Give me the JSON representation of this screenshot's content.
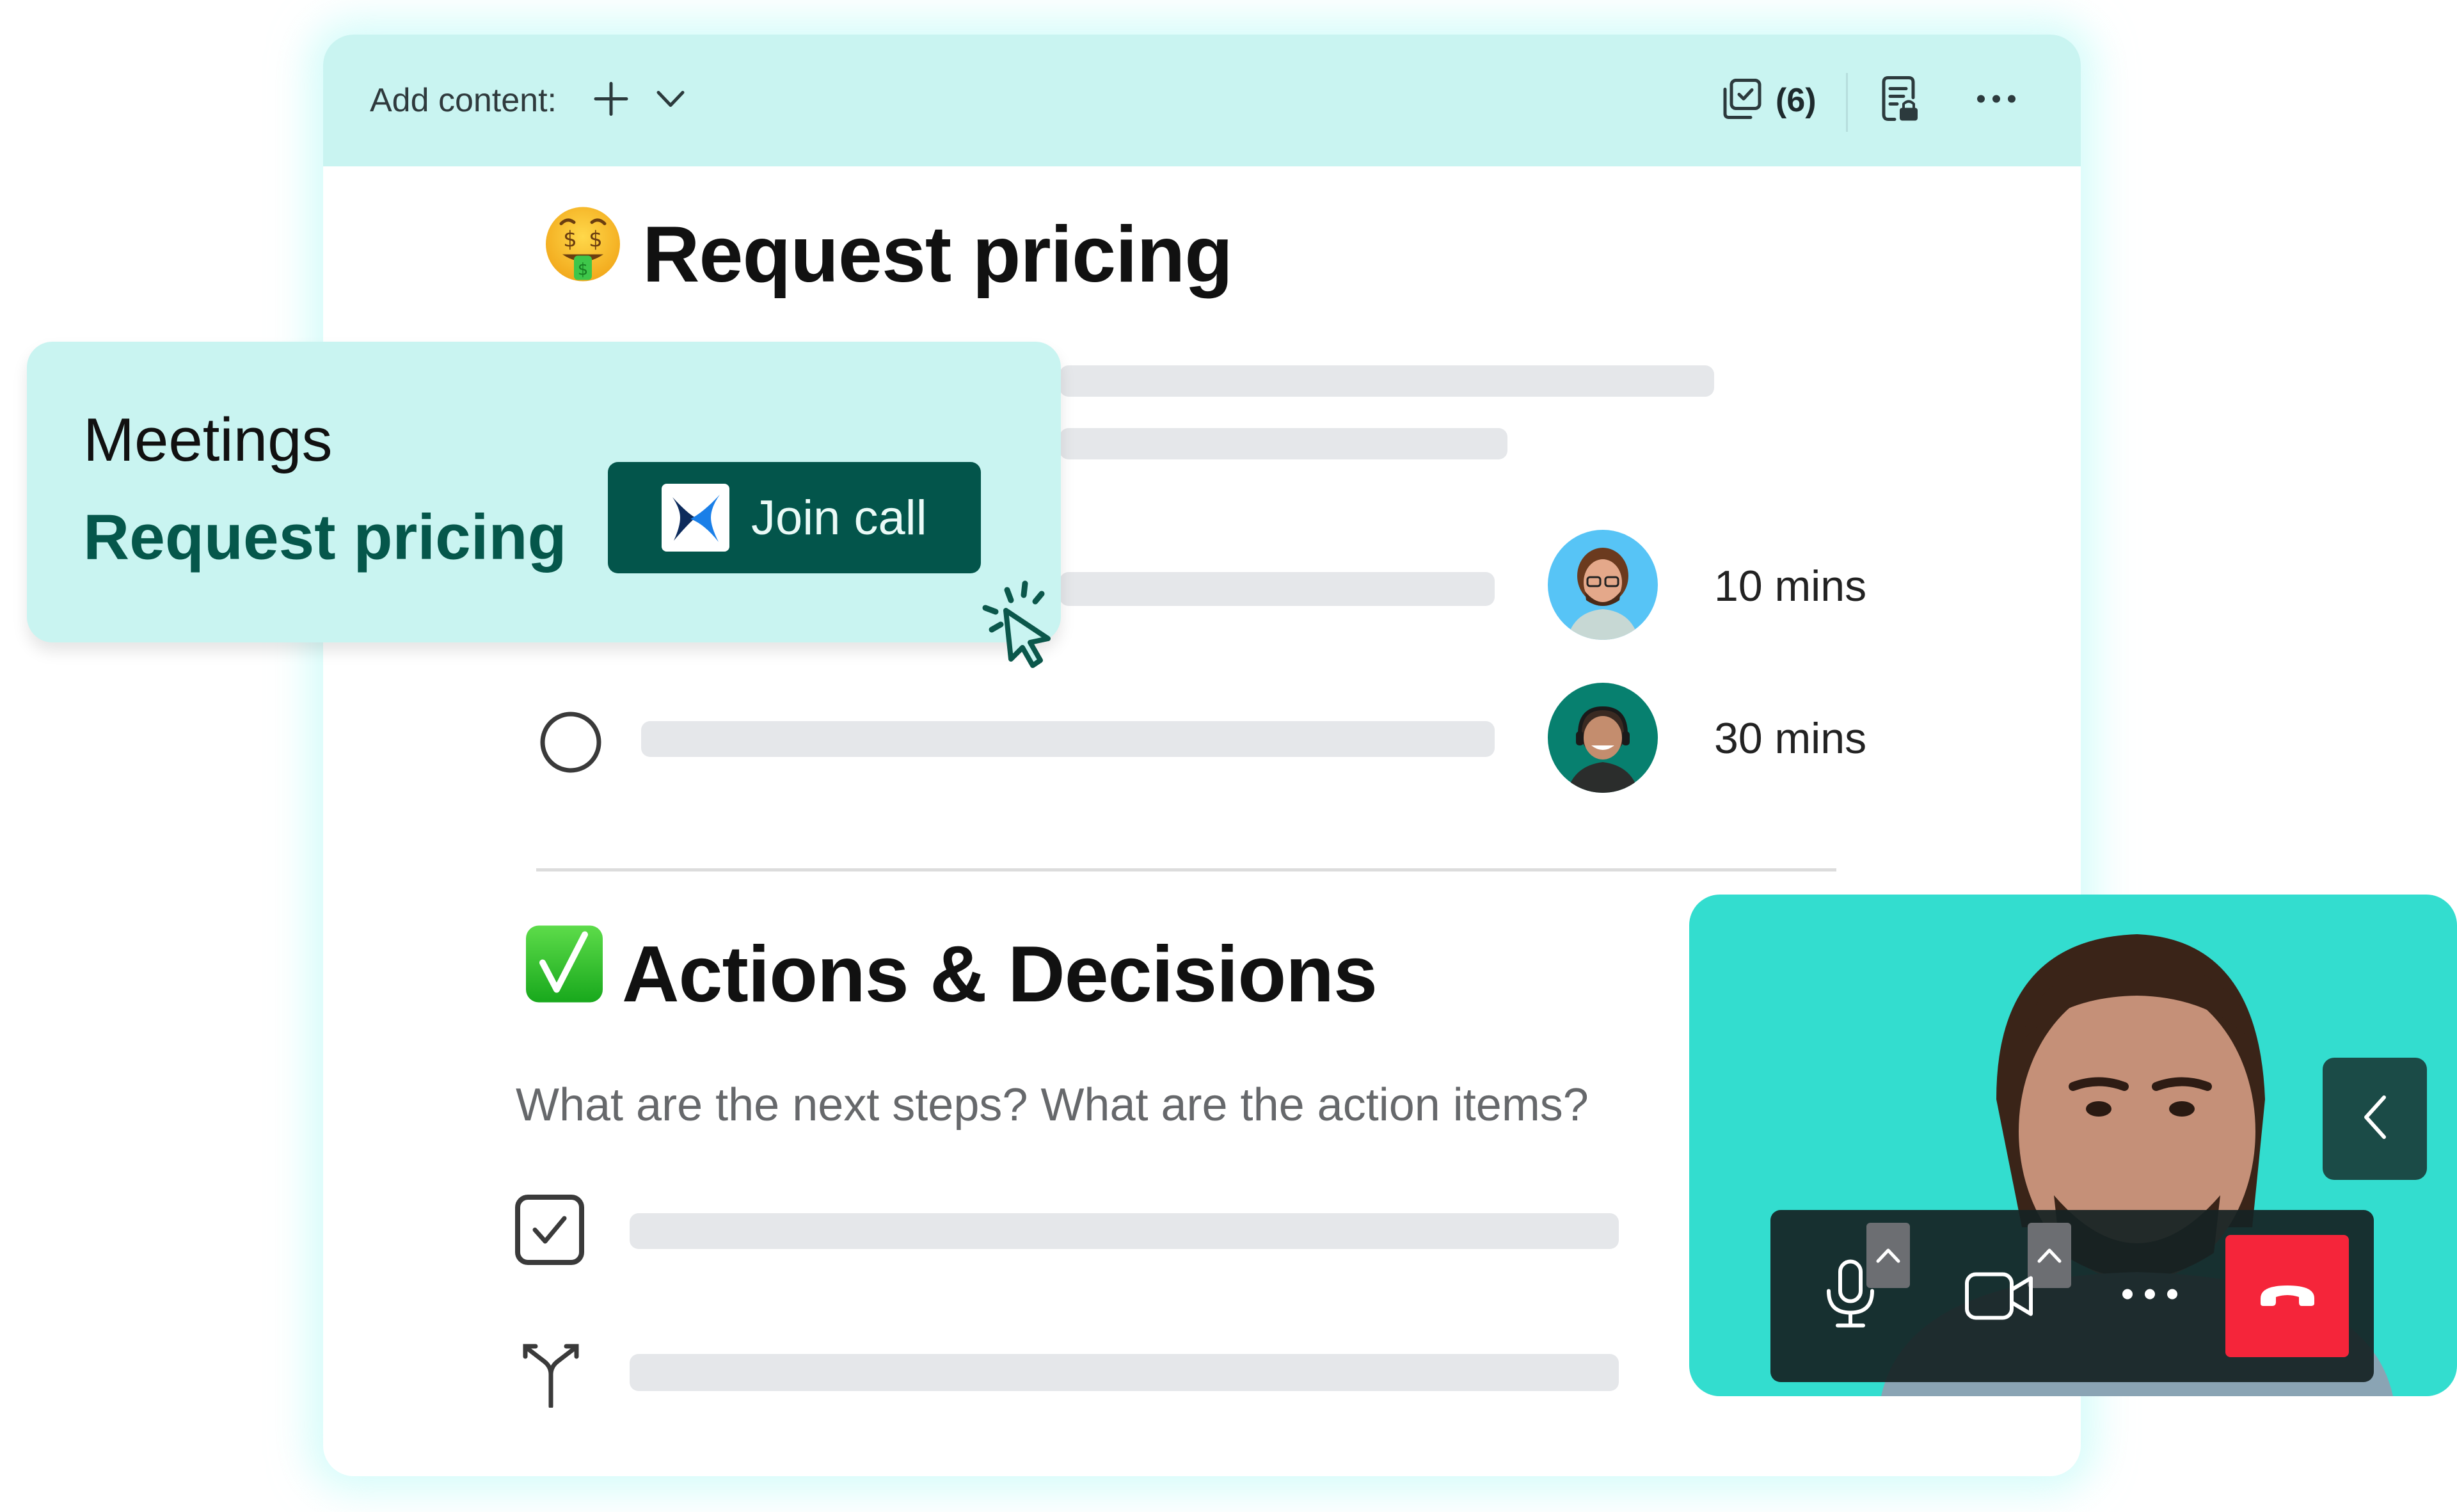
{
  "toolbar": {
    "add_content_label": "Add content:",
    "add_icon": "plus-icon",
    "dropdown_icon": "chevron-down-icon",
    "checklist_icon": "checklist-stack-icon",
    "checklist_count": "(6)",
    "doc_lock_icon": "document-lock-icon",
    "more_icon": "more-horizontal-icon"
  },
  "section1": {
    "emoji": "money-mouth-face",
    "title": "Request pricing",
    "rows": [
      {
        "status": "unknown",
        "duration": "10 mins",
        "avatar": "person-curly-hair-glasses"
      },
      {
        "status": "unchecked",
        "duration": "30 mins",
        "avatar": "person-headset"
      }
    ]
  },
  "section2": {
    "emoji": "check-mark-button",
    "title": "Actions & Decisions",
    "prompt": "What are the next steps? What are the action items?",
    "items": [
      {
        "icon": "checkbox-checked-icon"
      },
      {
        "icon": "decision-fork-icon"
      }
    ]
  },
  "meetings_popup": {
    "title": "Meetings",
    "meeting_name": "Request pricing",
    "join_button_label": "Join call"
  },
  "video_call": {
    "controls": [
      "microphone",
      "camera",
      "more",
      "end-call"
    ],
    "end_call_color": "#f5253a",
    "background_color": "#33ddcf"
  },
  "colors": {
    "toolbar_bg": "#c9f4f1",
    "accent_dark": "#03554b",
    "placeholder_bar": "#e5e7ea"
  }
}
